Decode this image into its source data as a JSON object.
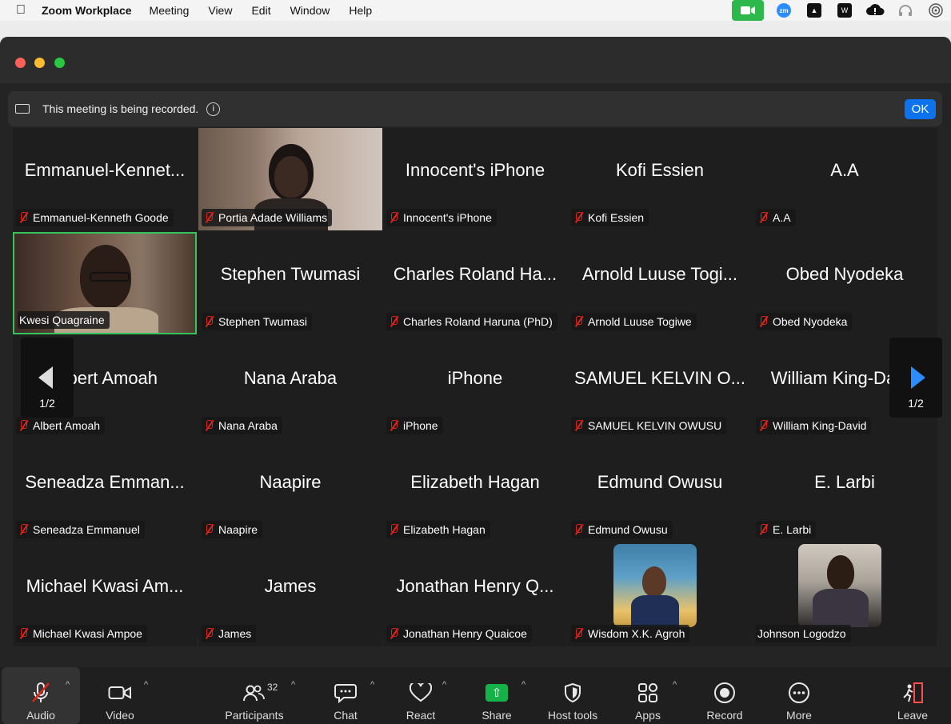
{
  "menubar": {
    "app_name": "Zoom Workplace",
    "items": [
      "Meeting",
      "View",
      "Edit",
      "Window",
      "Help"
    ]
  },
  "banner": {
    "message": "This meeting is being recorded.",
    "ok_label": "OK"
  },
  "gallery": {
    "tiles": [
      {
        "big": "Emmanuel-Kennet...",
        "label": "Emmanuel-Kenneth Goode",
        "muted": true
      },
      {
        "big": "",
        "label": "Portia Adade Williams",
        "muted": true,
        "video": true
      },
      {
        "big": "Innocent's iPhone",
        "label": "Innocent's iPhone",
        "muted": true
      },
      {
        "big": "Kofi Essien",
        "label": "Kofi Essien",
        "muted": true
      },
      {
        "big": "A.A",
        "label": "A.A",
        "muted": true
      },
      {
        "big": "",
        "label": "Kwesi Quagraine",
        "muted": false,
        "video": true,
        "active_speaker": true
      },
      {
        "big": "Stephen Twumasi",
        "label": "Stephen Twumasi",
        "muted": true
      },
      {
        "big": "Charles Roland Ha...",
        "label": "Charles Roland Haruna (PhD)",
        "muted": true
      },
      {
        "big": "Arnold Luuse Togi...",
        "label": "Arnold Luuse Togiwe",
        "muted": true
      },
      {
        "big": "Obed Nyodeka",
        "label": "Obed Nyodeka",
        "muted": true
      },
      {
        "big": "Albert Amoah",
        "label": "Albert Amoah",
        "muted": true
      },
      {
        "big": "Nana Araba",
        "label": "Nana Araba",
        "muted": true
      },
      {
        "big": "iPhone",
        "label": "iPhone",
        "muted": true
      },
      {
        "big": "SAMUEL KELVIN O...",
        "label": "SAMUEL KELVIN OWUSU",
        "muted": true
      },
      {
        "big": "William King-David",
        "label": "William King-David",
        "muted": true
      },
      {
        "big": "Seneadza Emman...",
        "label": "Seneadza Emmanuel",
        "muted": true
      },
      {
        "big": "Naapire",
        "label": "Naapire",
        "muted": true
      },
      {
        "big": "Elizabeth Hagan",
        "label": "Elizabeth Hagan",
        "muted": true
      },
      {
        "big": "Edmund Owusu",
        "label": "Edmund Owusu",
        "muted": true
      },
      {
        "big": "E. Larbi",
        "label": "E. Larbi",
        "muted": true
      },
      {
        "big": "Michael Kwasi Am...",
        "label": "Michael Kwasi Ampoe",
        "muted": true
      },
      {
        "big": "James",
        "label": "James",
        "muted": true
      },
      {
        "big": "Jonathan Henry Q...",
        "label": "Jonathan Henry Quaicoe",
        "muted": true
      },
      {
        "big": "",
        "label": "Wisdom X.K. Agroh",
        "muted": true,
        "photo": "wisdom"
      },
      {
        "big": "",
        "label": "Johnson Logodzo",
        "muted": false,
        "photo": "johnson"
      }
    ],
    "page_indicator": "1/2"
  },
  "toolbar": {
    "audio": "Audio",
    "video": "Video",
    "participants": "Participants",
    "participants_count": "32",
    "chat": "Chat",
    "react": "React",
    "share": "Share",
    "host_tools": "Host tools",
    "apps": "Apps",
    "record": "Record",
    "more": "More",
    "leave": "Leave"
  }
}
